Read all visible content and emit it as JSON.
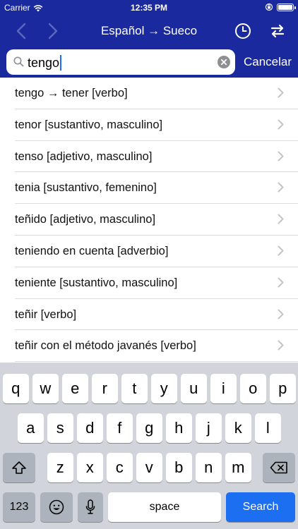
{
  "status": {
    "carrier": "Carrier",
    "time": "12:35 PM"
  },
  "nav": {
    "title": "Español → Sueco",
    "back_icon": "chevron-left-icon",
    "forward_icon": "chevron-right-icon",
    "history_icon": "clock-icon",
    "swap_icon": "swap-icon"
  },
  "search": {
    "value": "tengo",
    "cancel_label": "Cancelar"
  },
  "results": [
    "tengo → tener [verbo]",
    "tenor [sustantivo, masculino]",
    "tenso [adjetivo, masculino]",
    "tenia [sustantivo, femenino]",
    "teñido [adjetivo, masculino]",
    "teniendo en cuenta [adverbio]",
    "teniente [sustantivo, masculino]",
    "teñir [verbo]",
    "teñir con el método javanés [verbo]"
  ],
  "keyboard": {
    "row1": [
      "q",
      "w",
      "e",
      "r",
      "t",
      "y",
      "u",
      "i",
      "o",
      "p"
    ],
    "row2": [
      "a",
      "s",
      "d",
      "f",
      "g",
      "h",
      "j",
      "k",
      "l"
    ],
    "row3": [
      "z",
      "x",
      "c",
      "v",
      "b",
      "n",
      "m"
    ],
    "numbers_label": "123",
    "space_label": "space",
    "search_label": "Search"
  },
  "colors": {
    "nav_background": "#1a2a9e",
    "search_key": "#1d6ff2"
  }
}
